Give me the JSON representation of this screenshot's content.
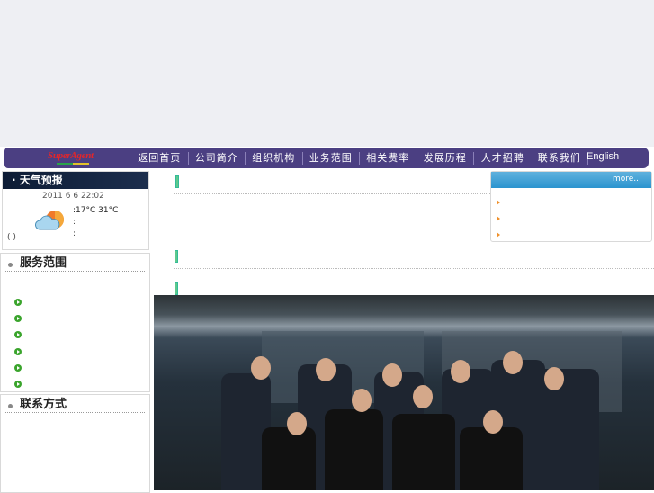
{
  "logo": {
    "text": "SuperAgent"
  },
  "nav": {
    "items": [
      "返回首页",
      "公司简介",
      "组织机构",
      "业务范围",
      "相关费率",
      "发展历程",
      "人才招聘"
    ],
    "contact": "联系我们",
    "english": "English"
  },
  "weather": {
    "title": "· 天气预报",
    "datetime": "2011 6 6  22:02",
    "temperature": ":17°C 31°C",
    "line2": ":",
    "line3": ":",
    "paren": "( )",
    "icon": "partly-cloudy-icon"
  },
  "service": {
    "title": "服务范围",
    "items": [
      "",
      "",
      "",
      "",
      "",
      ""
    ]
  },
  "contact": {
    "title": "联系方式"
  },
  "news": {
    "more": "more..",
    "items": [
      "",
      "",
      ""
    ]
  },
  "colors": {
    "nav": "#4b3f82",
    "news_header": "#2b94cf",
    "bullet_green": "#3aa42c",
    "bullet_orange": "#f0902a"
  }
}
